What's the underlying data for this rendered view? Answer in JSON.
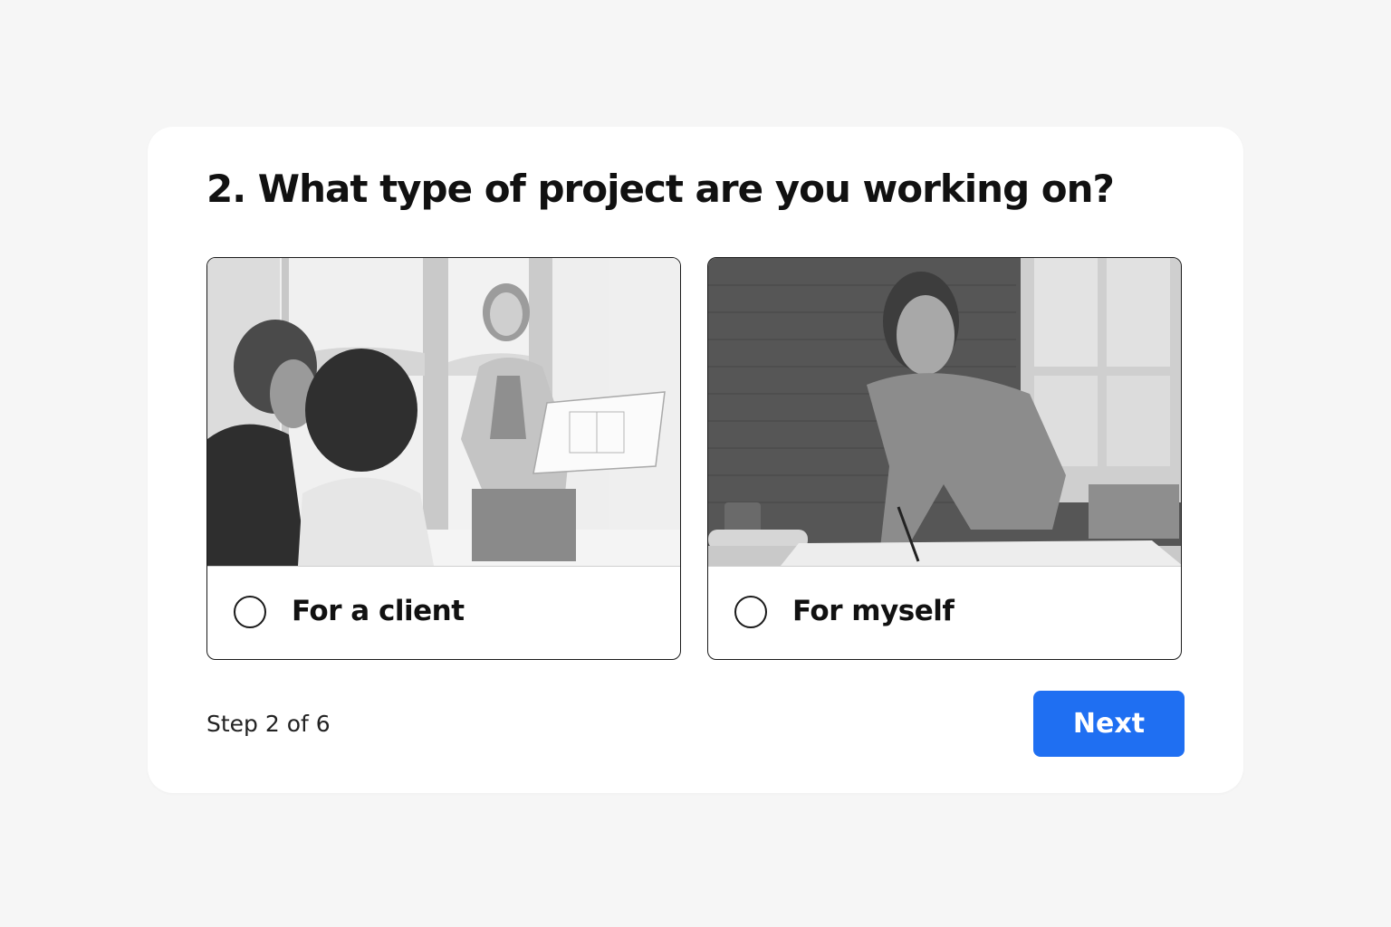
{
  "question": {
    "title": "2. What type of project are you working on?"
  },
  "options": [
    {
      "label": "For a client",
      "image": "client-meeting-photo",
      "selected": false
    },
    {
      "label": "For myself",
      "image": "man-drawing-plans-photo",
      "selected": false
    }
  ],
  "footer": {
    "step_text": "Step 2 of 6",
    "next_label": "Next"
  },
  "colors": {
    "accent": "#1f6ff2",
    "page_background": "#f6f6f6",
    "card_background": "#ffffff",
    "border": "#1a1a1a"
  }
}
